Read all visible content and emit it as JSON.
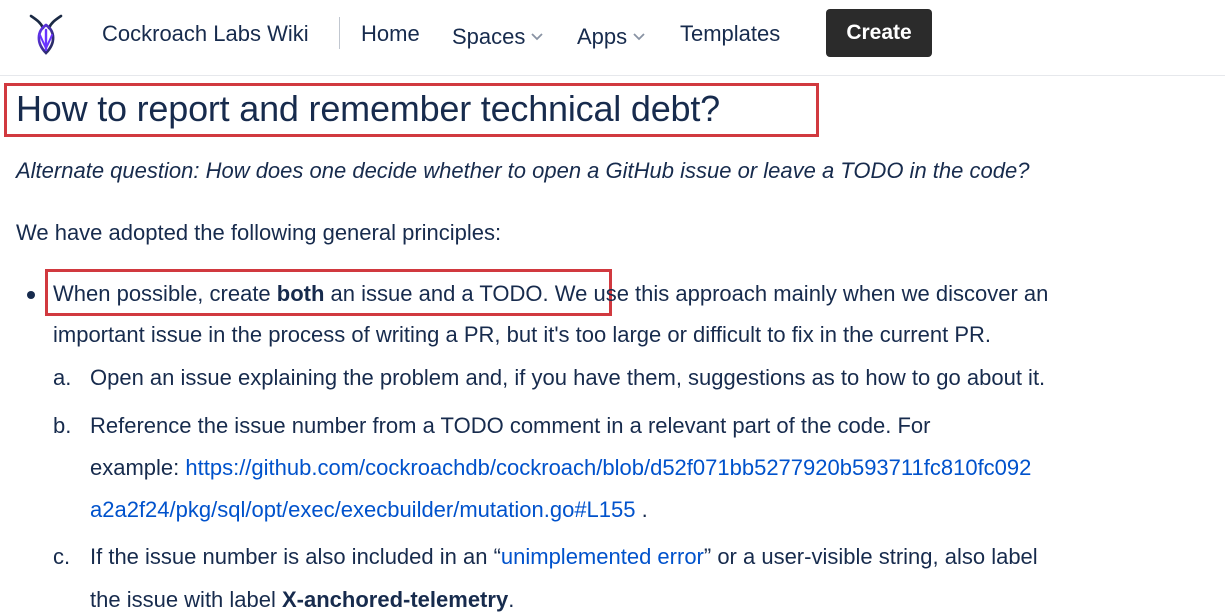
{
  "header": {
    "site_name": "Cockroach Labs Wiki",
    "nav": {
      "home": "Home",
      "spaces": "Spaces",
      "apps": "Apps",
      "templates": "Templates"
    },
    "create_label": "Create"
  },
  "page": {
    "title": "How to report and remember technical debt?",
    "alt_question": "Alternate question: How does one decide whether to open a GitHub issue or leave a TODO in the code?",
    "intro": "We have adopted the following general principles:",
    "bullet1": {
      "part1": "When possible, create ",
      "bold": "both",
      "part2": " an issue and a TODO.",
      "part3": " We use this approach mainly when we discover an",
      "line2": "important issue in the process of writing a PR, but it's too large or difficult to fix in the current PR."
    },
    "sub_items": {
      "a_marker": "a.",
      "a_text": "Open an issue explaining the problem and, if you have them, suggestions as to how to go about it.",
      "b_marker": "b.",
      "b_text1": "Reference the issue number from a TODO comment in a relevant part of the code. For",
      "b_text2_prefix": "example: ",
      "b_link_line1": "https://github.com/cockroachdb/cockroach/blob/d52f071bb5277920b593711fc810fc092",
      "b_link_line2": "a2a2f24/pkg/sql/opt/exec/execbuilder/mutation.go#L155",
      "b_text2_suffix": " .",
      "c_marker": "c.",
      "c_text1_prefix": "If the issue number is also included in an “",
      "c_link": "unimplemented error",
      "c_text1_suffix": "” or a user-visible string, also label",
      "c_text2_prefix": "the issue with label ",
      "c_bold": "X-anchored-telemetry",
      "c_text2_suffix": "."
    }
  },
  "colors": {
    "accent_red": "#d1393f",
    "link_blue": "#0052cc",
    "text": "#172b4d",
    "button_bg": "#2b2b2b"
  },
  "icons": {
    "logo": "cockroach-logo-icon",
    "chevron": "chevron-down-icon"
  }
}
